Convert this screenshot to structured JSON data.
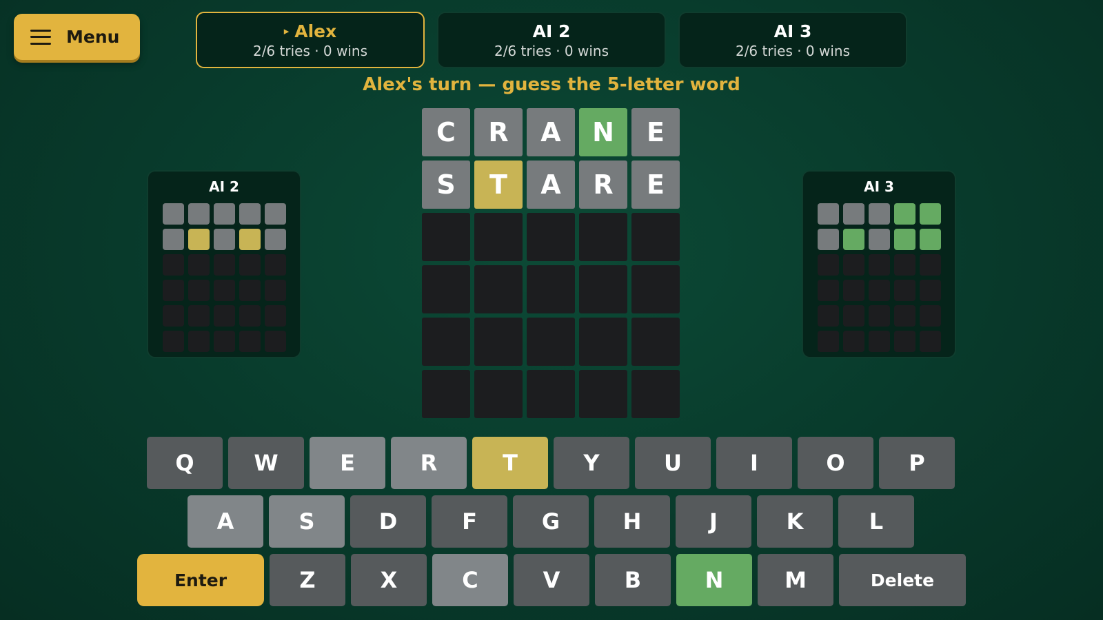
{
  "menu": {
    "label": "Menu",
    "icon": "hamburger-icon"
  },
  "players": [
    {
      "name": "Alex",
      "stats": "2/6 tries · 0 wins",
      "active": true,
      "marker": "▸"
    },
    {
      "name": "AI 2",
      "stats": "2/6 tries · 0 wins",
      "active": false
    },
    {
      "name": "AI 3",
      "stats": "2/6 tries · 0 wins",
      "active": false
    }
  ],
  "turn_message": "Alex's turn — guess the 5-letter word",
  "board": {
    "rows": [
      {
        "letters": [
          "C",
          "R",
          "A",
          "N",
          "E"
        ],
        "states": [
          "gray",
          "gray",
          "gray",
          "green",
          "gray"
        ]
      },
      {
        "letters": [
          "S",
          "T",
          "A",
          "R",
          "E"
        ],
        "states": [
          "gray",
          "yellow",
          "gray",
          "gray",
          "gray"
        ]
      },
      {
        "letters": [
          "",
          "",
          "",
          "",
          ""
        ],
        "states": [
          "empty",
          "empty",
          "empty",
          "empty",
          "empty"
        ]
      },
      {
        "letters": [
          "",
          "",
          "",
          "",
          ""
        ],
        "states": [
          "empty",
          "empty",
          "empty",
          "empty",
          "empty"
        ]
      },
      {
        "letters": [
          "",
          "",
          "",
          "",
          ""
        ],
        "states": [
          "empty",
          "empty",
          "empty",
          "empty",
          "empty"
        ]
      },
      {
        "letters": [
          "",
          "",
          "",
          "",
          ""
        ],
        "states": [
          "empty",
          "empty",
          "empty",
          "empty",
          "empty"
        ]
      }
    ]
  },
  "mini_boards": [
    {
      "title": "AI 2",
      "rows": [
        [
          "gray",
          "gray",
          "gray",
          "gray",
          "gray"
        ],
        [
          "gray",
          "yellow",
          "gray",
          "yellow",
          "gray"
        ],
        [
          "empty",
          "empty",
          "empty",
          "empty",
          "empty"
        ],
        [
          "empty",
          "empty",
          "empty",
          "empty",
          "empty"
        ],
        [
          "empty",
          "empty",
          "empty",
          "empty",
          "empty"
        ],
        [
          "empty",
          "empty",
          "empty",
          "empty",
          "empty"
        ]
      ]
    },
    {
      "title": "AI 3",
      "rows": [
        [
          "gray",
          "gray",
          "gray",
          "green",
          "green"
        ],
        [
          "gray",
          "green",
          "gray",
          "green",
          "green"
        ],
        [
          "empty",
          "empty",
          "empty",
          "empty",
          "empty"
        ],
        [
          "empty",
          "empty",
          "empty",
          "empty",
          "empty"
        ],
        [
          "empty",
          "empty",
          "empty",
          "empty",
          "empty"
        ],
        [
          "empty",
          "empty",
          "empty",
          "empty",
          "empty"
        ]
      ]
    }
  ],
  "keyboard": {
    "rows": [
      [
        {
          "label": "Q",
          "state": "unused"
        },
        {
          "label": "W",
          "state": "unused"
        },
        {
          "label": "E",
          "state": "absent"
        },
        {
          "label": "R",
          "state": "absent"
        },
        {
          "label": "T",
          "state": "present"
        },
        {
          "label": "Y",
          "state": "unused"
        },
        {
          "label": "U",
          "state": "unused"
        },
        {
          "label": "I",
          "state": "unused"
        },
        {
          "label": "O",
          "state": "unused"
        },
        {
          "label": "P",
          "state": "unused"
        }
      ],
      [
        {
          "label": "A",
          "state": "absent"
        },
        {
          "label": "S",
          "state": "absent"
        },
        {
          "label": "D",
          "state": "unused"
        },
        {
          "label": "F",
          "state": "unused"
        },
        {
          "label": "G",
          "state": "unused"
        },
        {
          "label": "H",
          "state": "unused"
        },
        {
          "label": "J",
          "state": "unused"
        },
        {
          "label": "K",
          "state": "unused"
        },
        {
          "label": "L",
          "state": "unused"
        }
      ],
      [
        {
          "label": "Enter",
          "state": "enter"
        },
        {
          "label": "Z",
          "state": "unused"
        },
        {
          "label": "X",
          "state": "unused"
        },
        {
          "label": "C",
          "state": "absent"
        },
        {
          "label": "V",
          "state": "unused"
        },
        {
          "label": "B",
          "state": "unused"
        },
        {
          "label": "N",
          "state": "correct"
        },
        {
          "label": "M",
          "state": "unused"
        },
        {
          "label": "Delete",
          "state": "delete"
        }
      ]
    ]
  },
  "colors": {
    "accent": "#e2b43e",
    "correct": "#65aa62",
    "present": "#c8b455",
    "absent": "#777b7d",
    "empty": "#1c1d1f"
  }
}
